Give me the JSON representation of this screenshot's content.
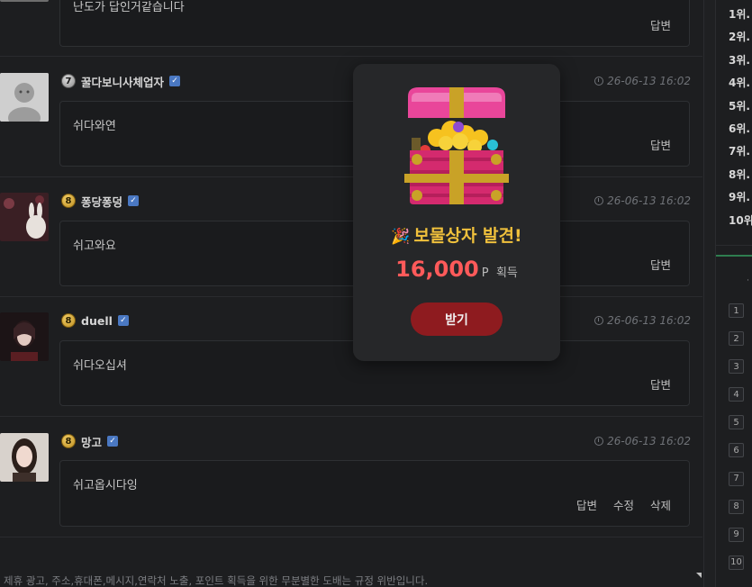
{
  "comments": [
    {
      "nickname": "",
      "level": "",
      "time": "",
      "content": "난도가 답인거같습니다",
      "actions": [
        "답변"
      ]
    },
    {
      "nickname": "꿀다보니사체업자",
      "level": "7",
      "time": "26-06-13 16:02",
      "content": "쉬다와연",
      "actions": [
        "답변"
      ]
    },
    {
      "nickname": "퐁당퐁덩",
      "level": "8",
      "time": "26-06-13 16:02",
      "content": "쉬고와요",
      "actions": [
        "답변"
      ]
    },
    {
      "nickname": "duell",
      "level": "8",
      "time": "26-06-13 16:02",
      "content": "쉬다오십셔",
      "actions": [
        "답변"
      ]
    },
    {
      "nickname": "망고",
      "level": "8",
      "time": "26-06-13 16:02",
      "content": "쉬고옵시다잉",
      "actions": [
        "답변",
        "수정",
        "삭제"
      ]
    }
  ],
  "notice": "제휴 광고, 주소,휴대폰,메시지,연락처 노출, 포인트 획득을 위한 무분별한 도배는 규정 위반입니다.",
  "sidebar": {
    "ranks": [
      "1위.",
      "2위.",
      "3위.",
      "4위.",
      "5위.",
      "6위.",
      "7위.",
      "8위.",
      "9위.",
      "10위"
    ],
    "numbers": [
      "1",
      "2",
      "3",
      "4",
      "5",
      "6",
      "7",
      "8",
      "9",
      "10"
    ],
    "colors": {
      "accent_line": "#2e7d4f"
    }
  },
  "popup": {
    "icon": "treasure-chest-icon",
    "title": "보물상자 발견!",
    "title_emoji": "🎉",
    "amount": "16,000",
    "unit": "P",
    "gain_label": "획득",
    "button_label": "받기",
    "colors": {
      "title": "#f0c13c",
      "amount": "#ff5a5a",
      "button": "#8e1b1f"
    }
  }
}
